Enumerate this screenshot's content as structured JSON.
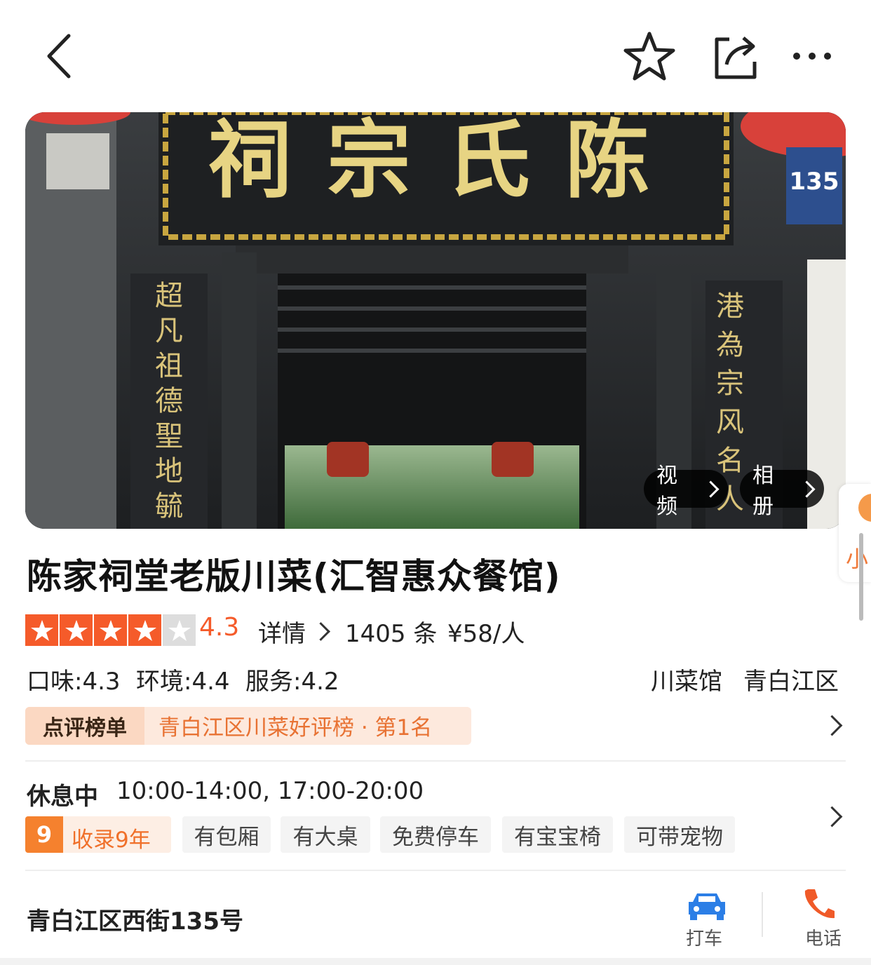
{
  "shop": {
    "name": "陈家祠堂老版川菜(汇智惠众餐馆)",
    "rating": "4.3",
    "rating_stars": 4,
    "rating_max": 5,
    "details_label": "详情",
    "review_count": "1405 条",
    "price": "¥58/人",
    "taste": "口味:4.3",
    "env": "环境:4.4",
    "service": "服务:4.2",
    "category": "川菜馆",
    "district": "青白江区"
  },
  "hero": {
    "video_label": "视频",
    "album_label": "相册",
    "sign_text": "祠宗氏陈",
    "plaque_number": "135"
  },
  "ranking": {
    "label": "点评榜单",
    "text": "青白江区川菜好评榜 · 第1名"
  },
  "hours": {
    "status": "休息中",
    "times": "10:00-14:00, 17:00-20:00"
  },
  "tags": {
    "years_badge": "9",
    "years_text": "收录9年",
    "items": [
      "有包厢",
      "有大桌",
      "免费停车",
      "有宝宝椅",
      "可带宠物"
    ]
  },
  "address": {
    "text": "青白江区西街135号",
    "taxi_label": "打车",
    "call_label": "电话"
  },
  "float_tab": {
    "label": "小"
  },
  "colors": {
    "accent": "#f55b2a",
    "rank_text": "#e87233",
    "taxi_blue": "#2b7ee6"
  }
}
